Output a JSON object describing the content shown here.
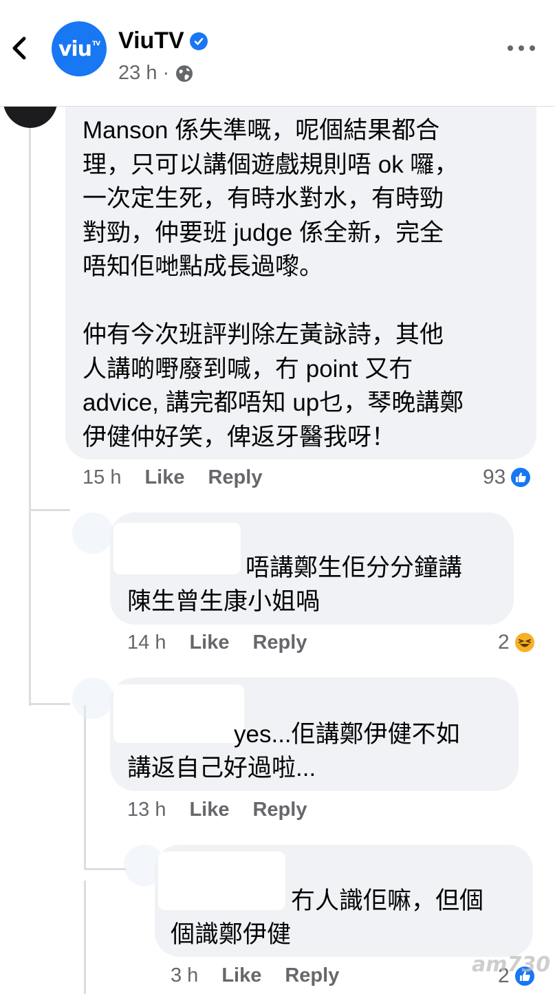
{
  "header": {
    "back_icon": "chevron-left-icon",
    "avatar_text": "viu",
    "avatar_sup": "TV",
    "page_name": "ViuTV",
    "verified_icon": "verified-badge-icon",
    "time": "23 h",
    "separator": "·",
    "audience_icon": "globe-icon",
    "more_icon": "more-horizontal-icon"
  },
  "colors": {
    "accent": "#1877f2",
    "bubble": "#f0f2f5",
    "muted": "#65676b",
    "haha": "#f7b125"
  },
  "comments": [
    {
      "lines": [
        "Manson 係失準嘅，呢個結果都合",
        "理，只可以講個遊戲規則唔 ok 囉，",
        "一次定生死，有時水對水，有時勁",
        "對勁，仲要班 judge 係全新，完全",
        "唔知佢哋點成長過嚟。",
        "",
        "仲有今次班評判除左黃詠詩，其他",
        "人講啲嘢廢到喊，冇 point 又冇",
        "advice, 講完都唔知 up乜，琴晚講鄭",
        "伊健仲好笑，俾返牙醫我呀！"
      ],
      "time": "15 h",
      "like": "Like",
      "reply": "Reply",
      "reaction_count": "93",
      "reaction": "like-icon"
    },
    {
      "lines": [
        "唔講鄭生佢分分鐘講",
        "陳生曾生康小姐喎"
      ],
      "time": "14 h",
      "like": "Like",
      "reply": "Reply",
      "reaction_count": "2",
      "reaction": "haha-icon"
    },
    {
      "lines": [
        "yes...佢講鄭伊健不如",
        "講返自己好過啦..."
      ],
      "time": "13 h",
      "like": "Like",
      "reply": "Reply"
    },
    {
      "lines": [
        "冇人識佢嘛，但個",
        "個識鄭伊健"
      ],
      "time": "3 h",
      "like": "Like",
      "reply": "Reply",
      "reaction_count": "2",
      "reaction": "like-icon"
    }
  ],
  "watermark": "am730"
}
